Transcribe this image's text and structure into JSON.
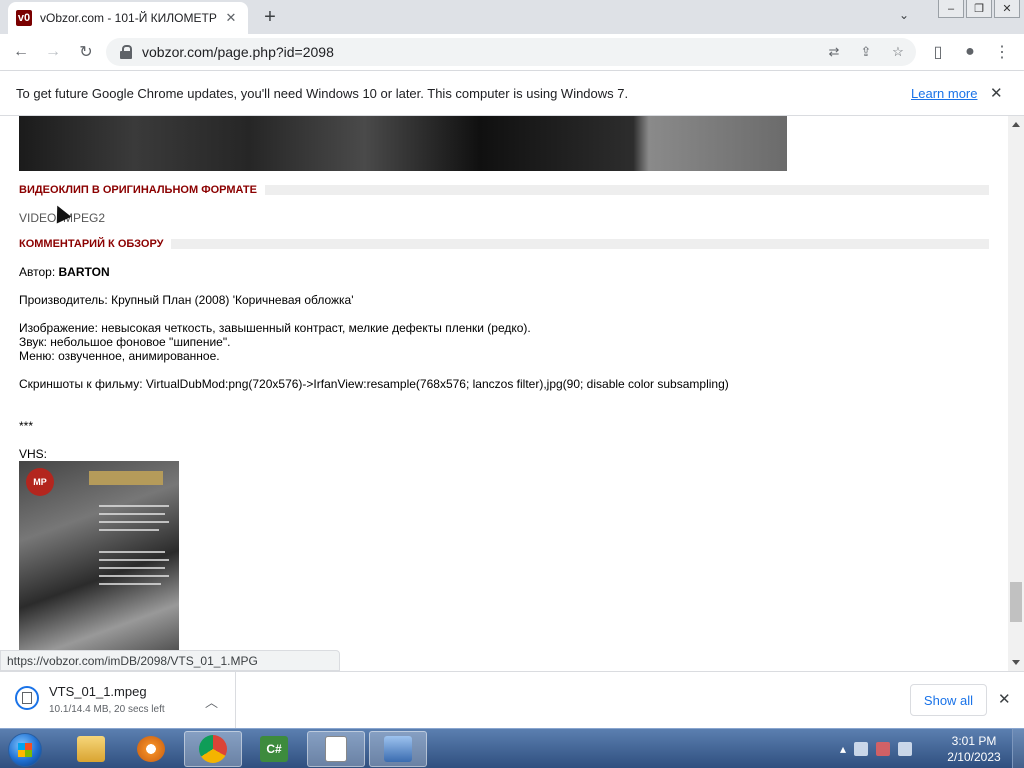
{
  "browser": {
    "tab_title": "vObzor.com - 101-Й КИЛОМЕТР",
    "favicon_text": "v0",
    "url": "vobzor.com/page.php?id=2098"
  },
  "infobar": {
    "message": "To get future Google Chrome updates, you'll need Windows 10 or later. This computer is using Windows 7.",
    "learn_more": "Learn more"
  },
  "page": {
    "section_video": "ВИДЕОКЛИП В ОРИГИНАЛЬНОМ ФОРМАТЕ",
    "video_link": "VIDEO: MPEG2",
    "section_comment": "КОММЕНТАРИЙ К ОБЗОРУ",
    "author_label": "Автор: ",
    "author_name": "BARTON",
    "producer": "Производитель: Крупный План (2008) 'Коричневая обложка'",
    "image_quality": "Изображение: невысокая четкость, завышенный контраст, мелкие дефекты пленки (редко).",
    "sound": "Звук: небольшое фоновое \"шипение\".",
    "menu": "Меню: озвученное, анимированное.",
    "screenshots": "Скриншоты к фильму: VirtualDubMod:png(720x576)->IrfanView:resample(768x576; lanczos filter),jpg(90; disable color subsampling)",
    "separator": "***",
    "vhs_label": "VHS:"
  },
  "status_url": "https://vobzor.com/imDB/2098/VTS_01_1.MPG",
  "downloads": {
    "file_name": "VTS_01_1.mpeg",
    "progress": "10.1/14.4 MB, 20 secs left",
    "show_all": "Show all"
  },
  "taskbar": {
    "time": "3:01 PM",
    "date": "2/10/2023"
  }
}
